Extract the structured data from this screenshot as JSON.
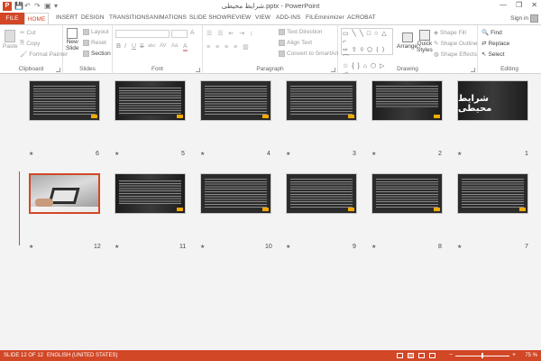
{
  "window": {
    "title": "شرایط محیطی.pptx - PowerPoint",
    "minimize": "—",
    "restore": "❐",
    "close": "✕"
  },
  "qat": {
    "app_badge": "P",
    "save": "💾",
    "undo": "↶",
    "redo": "↷",
    "present": "▣",
    "customize": "▾"
  },
  "tabs": [
    "FILE",
    "HOME",
    "INSERT",
    "DESIGN",
    "TRANSITIONS",
    "ANIMATIONS",
    "SLIDE SHOW",
    "REVIEW",
    "VIEW",
    "ADD-INS",
    "FILEminimizer",
    "ACROBAT"
  ],
  "account": {
    "sign_in": "Sign in"
  },
  "ribbon": {
    "clipboard": {
      "label": "Clipboard",
      "paste": "Paste",
      "cut": "Cut",
      "copy": "Copy",
      "format_painter": "Format Painter"
    },
    "slides": {
      "label": "Slides",
      "new_slide": "New",
      "new_slide2": "Slide",
      "layout": "Layout",
      "reset": "Reset",
      "section": "Section"
    },
    "font": {
      "label": "Font",
      "bold": "B",
      "italic": "I",
      "underline": "U",
      "strike": "S",
      "shadow": "abc",
      "spacing": "AV",
      "case": "Aa",
      "color": "A"
    },
    "paragraph": {
      "label": "Paragraph",
      "text_direction": "Text Direction",
      "align_text": "Align Text",
      "smartart": "Convert to SmartArt"
    },
    "drawing": {
      "label": "Drawing",
      "arrange": "Arrange",
      "quick_styles": "Quick",
      "quick_styles2": "Styles",
      "shape_fill": "Shape Fill",
      "shape_outline": "Shape Outline",
      "shape_effects": "Shape Effects"
    },
    "editing": {
      "label": "Editing",
      "find": "Find",
      "replace": "Replace",
      "select": "Select"
    }
  },
  "slides": [
    {
      "num": "1",
      "title": "شرایط محیطی"
    },
    {
      "num": "2"
    },
    {
      "num": "3"
    },
    {
      "num": "4"
    },
    {
      "num": "5"
    },
    {
      "num": "6"
    },
    {
      "num": "7"
    },
    {
      "num": "8"
    },
    {
      "num": "9"
    },
    {
      "num": "10"
    },
    {
      "num": "11"
    },
    {
      "num": "12"
    }
  ],
  "transition_marker": "★",
  "status": {
    "slide": "SLIDE 12 OF 12",
    "language": "ENGLISH (UNITED STATES)",
    "zoom": "75 %",
    "zoom_out": "−",
    "zoom_in": "+",
    "zoom_level": 0.5
  }
}
